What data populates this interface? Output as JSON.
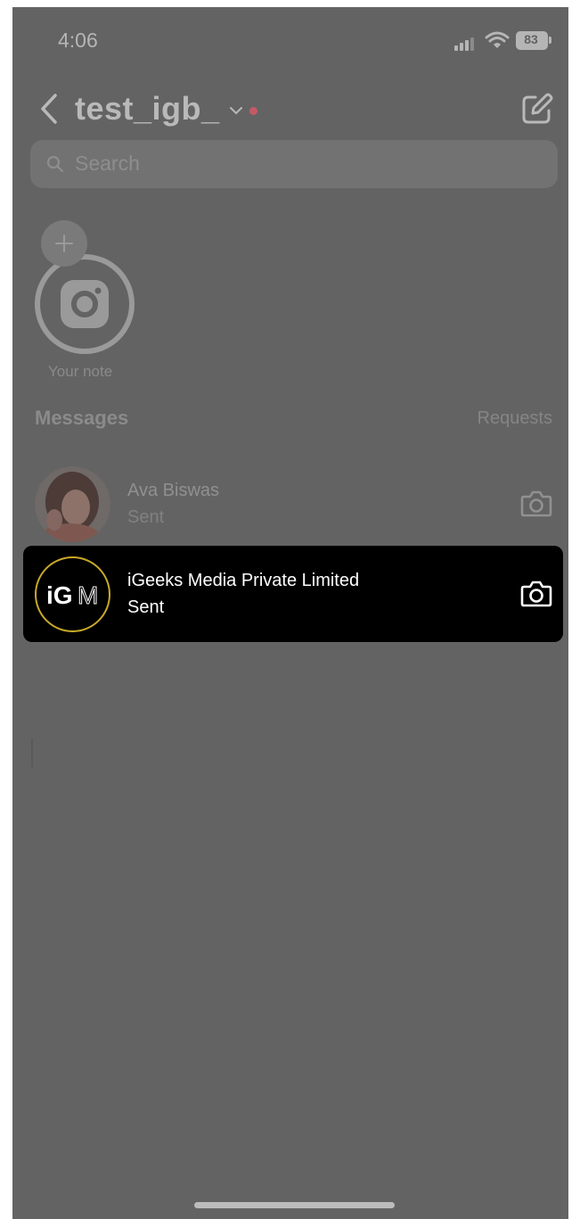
{
  "status_bar": {
    "time": "4:06",
    "battery": "83"
  },
  "header": {
    "account_name": "test_igb_"
  },
  "search": {
    "placeholder": "Search"
  },
  "note": {
    "label": "Your note"
  },
  "messages": {
    "title": "Messages",
    "requests_label": "Requests",
    "threads": [
      {
        "name": "Ava Biswas",
        "status": "Sent"
      },
      {
        "name": "iGeeks Media Private Limited",
        "status": "Sent"
      }
    ]
  },
  "logo": {
    "text_left": "iG",
    "text_right": "M"
  },
  "colors": {
    "background_overlay": "#636363",
    "highlight_row": "#000000",
    "notification_dot": "#c45a64",
    "logo_ring": "#c9a927"
  },
  "icons": [
    "back-icon",
    "chevron-down-icon",
    "compose-icon",
    "search-icon",
    "plus-icon",
    "instagram-icon",
    "camera-icon"
  ]
}
